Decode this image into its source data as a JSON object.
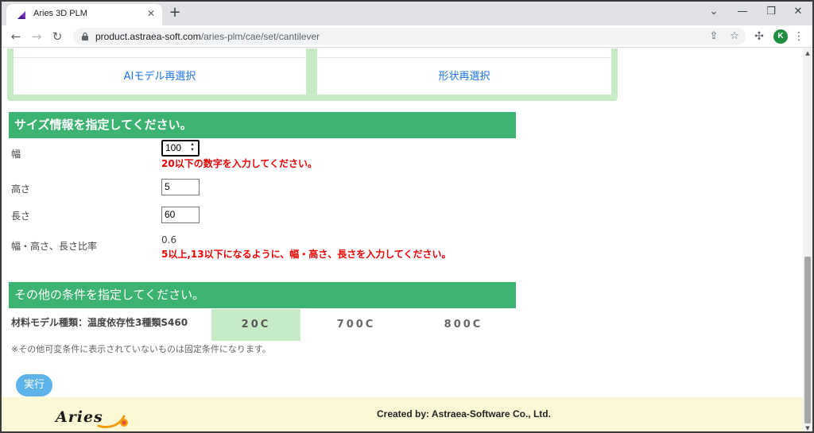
{
  "browser": {
    "tab_title": "Aries 3D PLM",
    "url_host": "product.astraea-soft.com",
    "url_path": "/aries-plm/cae/set/cantilever",
    "profile_initial": "K",
    "icons": [
      "back-icon",
      "forward-icon",
      "reload-icon",
      "lock-icon",
      "share-icon",
      "star-icon",
      "extensions-icon",
      "menu-icon"
    ]
  },
  "top_cards": {
    "ai_reselect": "AIモデル再選択",
    "shape_reselect": "形状再選択"
  },
  "size_section": {
    "title": "サイズ情報を指定してください。",
    "width_label": "幅",
    "width_value": "100",
    "width_error": "20以下の数字を入力してください。",
    "height_label": "高さ",
    "height_value": "5",
    "length_label": "長さ",
    "length_value": "60",
    "ratio_label": "幅・高さ、長さ比率",
    "ratio_value": "0.6",
    "ratio_error": "5以上,13以下になるように、幅・高さ、長さを入力してください。"
  },
  "other_section": {
    "title": "その他の条件を指定してください。",
    "material_label": "材料モデル種類：温度依存性3種類S460",
    "temperatures": [
      "20C",
      "700C",
      "800C"
    ],
    "selected_temperature": "20C",
    "note": "※その他可変条件に表示されていないものは固定条件になります。"
  },
  "run_button": "実行",
  "footer": {
    "logo_text": "Aries",
    "credit": "Created by: Astraea-Software Co., Ltd."
  },
  "colors": {
    "section_green": "#3cb371",
    "light_green": "#c7eac7",
    "error_red": "#ee0000",
    "link_blue": "#1a73e8",
    "run_blue": "#5cb3e8",
    "footer_bg": "#fbf8d5"
  }
}
